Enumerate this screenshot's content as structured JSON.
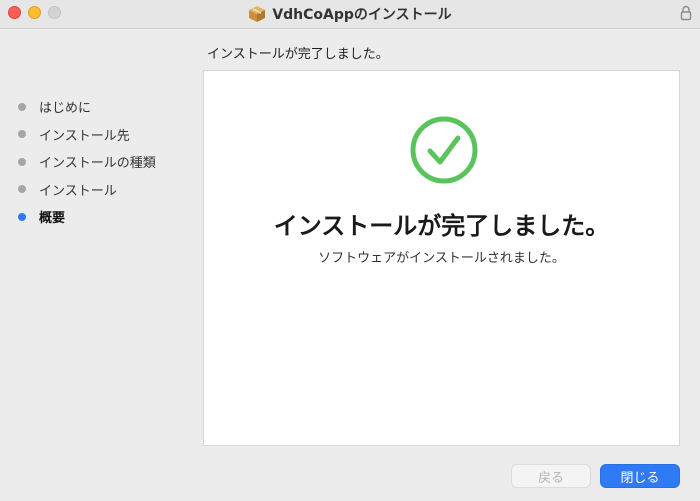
{
  "window": {
    "title": "VdhCoAppのインストール"
  },
  "header": {
    "status": "インストールが完了しました。"
  },
  "sidebar": {
    "steps": [
      {
        "label": "はじめに",
        "active": false
      },
      {
        "label": "インストール先",
        "active": false
      },
      {
        "label": "インストールの種類",
        "active": false
      },
      {
        "label": "インストール",
        "active": false
      },
      {
        "label": "概要",
        "active": true
      }
    ]
  },
  "content": {
    "title": "インストールが完了しました。",
    "subtitle": "ソフトウェアがインストールされました。"
  },
  "buttons": {
    "back_label": "戻る",
    "close_label": "閉じる"
  },
  "colors": {
    "accent": "#2f7bf5",
    "success": "#5ac35b",
    "inactive_dot": "#a6a6a6"
  },
  "icons": {
    "package": "package-icon",
    "lock": "lock-icon",
    "success": "checkmark-circle-icon"
  }
}
